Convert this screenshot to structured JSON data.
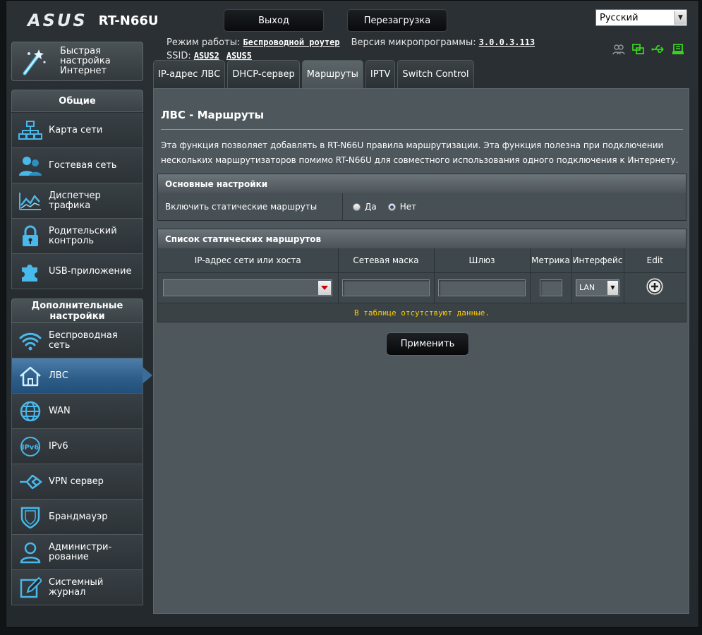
{
  "header": {
    "logo": "ASUS",
    "model": "RT-N66U",
    "logout_label": "Выход",
    "reboot_label": "Перезагрузка",
    "language": "Русский",
    "mode_label": "Режим работы:",
    "mode_value": "Беспроводной роутер",
    "firmware_label": "Версия микропрограммы:",
    "firmware_value": "3.0.0.3.113",
    "ssid_label": "SSID:",
    "ssid1": "ASUS2",
    "ssid2": "ASUS5"
  },
  "sidebar": {
    "quick_label_1": "Быстрая",
    "quick_label_2": "настройка",
    "quick_label_3": "Интернет",
    "general_title": "Общие",
    "general_items": [
      {
        "label": "Карта сети",
        "icon": "network-map-icon"
      },
      {
        "label": "Гостевая сеть",
        "icon": "guest-network-icon"
      },
      {
        "label": "Диспетчер трафика",
        "icon": "traffic-manager-icon"
      },
      {
        "label": "Родительский контроль",
        "icon": "parental-control-icon"
      },
      {
        "label": "USB-приложение",
        "icon": "usb-app-icon"
      }
    ],
    "advanced_title_1": "Дополнительные",
    "advanced_title_2": "настройки",
    "advanced_items": [
      {
        "label": "Беспроводная сеть",
        "icon": "wireless-icon"
      },
      {
        "label": "ЛВС",
        "icon": "lan-icon"
      },
      {
        "label": "WAN",
        "icon": "wan-icon"
      },
      {
        "label": "IPv6",
        "icon": "ipv6-icon"
      },
      {
        "label": "VPN сервер",
        "icon": "vpn-icon"
      },
      {
        "label": "Брандмауэр",
        "icon": "firewall-icon"
      },
      {
        "label": "Администри-рование",
        "icon": "admin-icon"
      },
      {
        "label": "Системный журнал",
        "icon": "syslog-icon"
      }
    ]
  },
  "tabs": [
    {
      "label": "IP-адрес ЛВС"
    },
    {
      "label": "DHCP-сервер"
    },
    {
      "label": "Маршруты"
    },
    {
      "label": "IPTV"
    },
    {
      "label": "Switch Control"
    }
  ],
  "main": {
    "title": "ЛВС - Маршруты",
    "description": "Эта функция позволяет добавлять в RT-N66U правила маршрутизации. Эта функция полезна при подключении нескольких маршрутизаторов помимо RT-N66U для совместного использования одного подключения к Интернету.",
    "basic_header": "Основные настройки",
    "enable_label": "Включить статические маршруты",
    "yes_label": "Да",
    "no_label": "Нет",
    "list_header": "Список статических маршрутов",
    "columns": [
      "IP-адрес сети или хоста",
      "Сетевая маска",
      "Шлюз",
      "Метрика",
      "Интерфейс",
      "Edit"
    ],
    "interface_value": "LAN",
    "no_data": "В таблице отсутствуют данные.",
    "apply_label": "Применить"
  }
}
